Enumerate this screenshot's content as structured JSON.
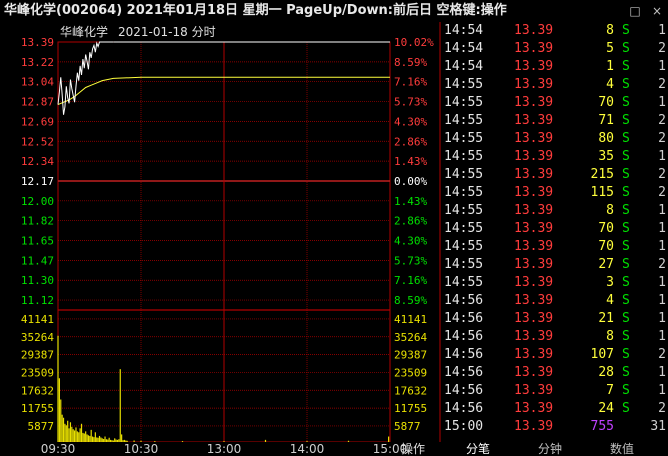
{
  "window": {
    "title": "华峰化学(002064)  2021年01月18日 星期一  PageUp/Down:前后日 空格键:操作",
    "controls": [
      "□",
      "×"
    ]
  },
  "chart_header": {
    "name": "华峰化学",
    "date": "2021-01-18",
    "mode": "分时"
  },
  "chart_data": {
    "type": "line",
    "price_axis_left": [
      "13.39",
      "13.22",
      "13.04",
      "12.87",
      "12.69",
      "12.52",
      "12.34",
      "12.17",
      "12.00",
      "11.82",
      "11.65",
      "11.47",
      "11.30",
      "11.12"
    ],
    "price_axis_right": [
      "10.02%",
      "8.59%",
      "7.16%",
      "5.73%",
      "4.30%",
      "2.86%",
      "1.43%",
      "0.00%",
      "1.43%",
      "2.86%",
      "4.30%",
      "5.73%",
      "7.16%",
      "8.59%"
    ],
    "prev_close": 12.17,
    "ylim": [
      11.12,
      13.39
    ],
    "volume_axis": [
      "41141",
      "35264",
      "29387",
      "23509",
      "17632",
      "11755",
      "5877"
    ],
    "volume_ylim": [
      0,
      41141
    ],
    "time_axis": [
      "09:30",
      "10:30",
      "13:00",
      "14:00",
      "15:00"
    ],
    "price_series": [
      [
        0,
        12.84
      ],
      [
        1,
        12.95
      ],
      [
        2,
        13.08
      ],
      [
        3,
        12.93
      ],
      [
        4,
        12.75
      ],
      [
        5,
        12.82
      ],
      [
        6,
        13.0
      ],
      [
        7,
        12.9
      ],
      [
        8,
        12.85
      ],
      [
        9,
        13.06
      ],
      [
        10,
        12.98
      ],
      [
        11,
        12.92
      ],
      [
        12,
        12.86
      ],
      [
        13,
        13.0
      ],
      [
        14,
        13.12
      ],
      [
        15,
        13.05
      ],
      [
        16,
        13.18
      ],
      [
        17,
        13.1
      ],
      [
        18,
        13.24
      ],
      [
        19,
        13.16
      ],
      [
        20,
        13.28
      ],
      [
        21,
        13.22
      ],
      [
        22,
        13.15
      ],
      [
        23,
        13.3
      ],
      [
        24,
        13.25
      ],
      [
        25,
        13.33
      ],
      [
        26,
        13.36
      ],
      [
        27,
        13.3
      ],
      [
        28,
        13.38
      ],
      [
        29,
        13.35
      ],
      [
        30,
        13.39
      ],
      [
        31,
        13.39
      ],
      [
        32,
        13.39
      ],
      [
        33,
        13.39
      ],
      [
        34,
        13.39
      ],
      [
        35,
        13.39
      ],
      [
        36,
        13.39
      ],
      [
        37,
        13.39
      ],
      [
        38,
        13.39
      ],
      [
        39,
        13.39
      ],
      [
        40,
        13.39
      ]
    ],
    "avg_series": [
      [
        0,
        12.84
      ],
      [
        4,
        12.86
      ],
      [
        8,
        12.88
      ],
      [
        12,
        12.91
      ],
      [
        16,
        12.95
      ],
      [
        20,
        12.99
      ],
      [
        24,
        13.01
      ],
      [
        28,
        13.03
      ],
      [
        32,
        13.05
      ],
      [
        36,
        13.06
      ],
      [
        40,
        13.07
      ],
      [
        60,
        13.08
      ],
      [
        120,
        13.08
      ],
      [
        180,
        13.08
      ],
      [
        240,
        13.08
      ]
    ],
    "volume_series": [
      [
        0,
        35000
      ],
      [
        1,
        21000
      ],
      [
        2,
        14000
      ],
      [
        3,
        9000
      ],
      [
        4,
        8000
      ],
      [
        5,
        6000
      ],
      [
        6,
        5500
      ],
      [
        7,
        7000
      ],
      [
        8,
        4500
      ],
      [
        9,
        6500
      ],
      [
        10,
        5000
      ],
      [
        11,
        4200
      ],
      [
        12,
        3800
      ],
      [
        13,
        4800
      ],
      [
        14,
        3500
      ],
      [
        15,
        3200
      ],
      [
        16,
        4500
      ],
      [
        17,
        6000
      ],
      [
        18,
        3000
      ],
      [
        19,
        2800
      ],
      [
        20,
        3500
      ],
      [
        21,
        2500
      ],
      [
        22,
        2200
      ],
      [
        23,
        2000
      ],
      [
        24,
        4000
      ],
      [
        25,
        1800
      ],
      [
        26,
        1600
      ],
      [
        27,
        3200
      ],
      [
        28,
        1500
      ],
      [
        29,
        1400
      ],
      [
        30,
        2000
      ],
      [
        31,
        1500
      ],
      [
        32,
        1200
      ],
      [
        33,
        1000
      ],
      [
        34,
        1800
      ],
      [
        35,
        900
      ],
      [
        36,
        800
      ],
      [
        37,
        1400
      ],
      [
        38,
        700
      ],
      [
        39,
        600
      ],
      [
        40,
        500
      ],
      [
        41,
        1200
      ],
      [
        42,
        800
      ],
      [
        43,
        700
      ],
      [
        44,
        900
      ],
      [
        45,
        24000
      ],
      [
        46,
        2500
      ],
      [
        47,
        600
      ],
      [
        48,
        700
      ],
      [
        49,
        500
      ],
      [
        50,
        400
      ],
      [
        55,
        500
      ],
      [
        60,
        400
      ],
      [
        70,
        300
      ],
      [
        90,
        300
      ],
      [
        120,
        300
      ],
      [
        150,
        700
      ],
      [
        180,
        300
      ],
      [
        210,
        400
      ],
      [
        239,
        1800
      ]
    ]
  },
  "ticks": [
    {
      "time": "14:54",
      "price": "13.39",
      "vol": "8",
      "flag": "S",
      "n": "1"
    },
    {
      "time": "14:54",
      "price": "13.39",
      "vol": "5",
      "flag": "S",
      "n": "2"
    },
    {
      "time": "14:54",
      "price": "13.39",
      "vol": "1",
      "flag": "S",
      "n": "1"
    },
    {
      "time": "14:55",
      "price": "13.39",
      "vol": "4",
      "flag": "S",
      "n": "2"
    },
    {
      "time": "14:55",
      "price": "13.39",
      "vol": "70",
      "flag": "S",
      "n": "1"
    },
    {
      "time": "14:55",
      "price": "13.39",
      "vol": "71",
      "flag": "S",
      "n": "2"
    },
    {
      "time": "14:55",
      "price": "13.39",
      "vol": "80",
      "flag": "S",
      "n": "2"
    },
    {
      "time": "14:55",
      "price": "13.39",
      "vol": "35",
      "flag": "S",
      "n": "1"
    },
    {
      "time": "14:55",
      "price": "13.39",
      "vol": "215",
      "flag": "S",
      "n": "2"
    },
    {
      "time": "14:55",
      "price": "13.39",
      "vol": "115",
      "flag": "S",
      "n": "2"
    },
    {
      "time": "14:55",
      "price": "13.39",
      "vol": "8",
      "flag": "S",
      "n": "1"
    },
    {
      "time": "14:55",
      "price": "13.39",
      "vol": "70",
      "flag": "S",
      "n": "1"
    },
    {
      "time": "14:55",
      "price": "13.39",
      "vol": "70",
      "flag": "S",
      "n": "1"
    },
    {
      "time": "14:55",
      "price": "13.39",
      "vol": "27",
      "flag": "S",
      "n": "2"
    },
    {
      "time": "14:55",
      "price": "13.39",
      "vol": "3",
      "flag": "S",
      "n": "1"
    },
    {
      "time": "14:56",
      "price": "13.39",
      "vol": "4",
      "flag": "S",
      "n": "1"
    },
    {
      "time": "14:56",
      "price": "13.39",
      "vol": "21",
      "flag": "S",
      "n": "1"
    },
    {
      "time": "14:56",
      "price": "13.39",
      "vol": "8",
      "flag": "S",
      "n": "1"
    },
    {
      "time": "14:56",
      "price": "13.39",
      "vol": "107",
      "flag": "S",
      "n": "2"
    },
    {
      "time": "14:56",
      "price": "13.39",
      "vol": "28",
      "flag": "S",
      "n": "1"
    },
    {
      "time": "14:56",
      "price": "13.39",
      "vol": "7",
      "flag": "S",
      "n": "1"
    },
    {
      "time": "14:56",
      "price": "13.39",
      "vol": "24",
      "flag": "S",
      "n": "2"
    },
    {
      "time": "15:00",
      "price": "13.39",
      "vol": "755",
      "flag": "",
      "n": "31"
    }
  ],
  "bottom": {
    "operate": "操作",
    "tabs": [
      "分笔",
      "分钟",
      "数值"
    ],
    "active_tab": 0
  },
  "colors": {
    "grid_red": "#b00000",
    "up_red": "#ff3c3c",
    "down_green": "#00e000",
    "price_white": "#ffffff",
    "avg_yellow": "#ffff3c",
    "vol_yellow": "#e8e000",
    "purple": "#c040ff"
  }
}
